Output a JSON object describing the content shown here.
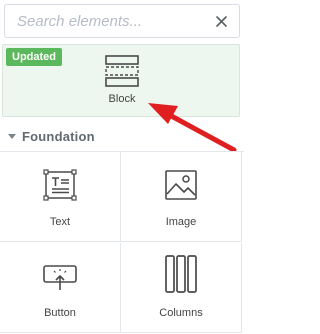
{
  "search": {
    "placeholder": "Search elements..."
  },
  "updated_element": {
    "badge": "Updated",
    "label": "Block",
    "icon": "block-icon"
  },
  "section": {
    "title": "Foundation"
  },
  "elements": [
    {
      "label": "Text",
      "icon": "text-icon"
    },
    {
      "label": "Image",
      "icon": "image-icon"
    },
    {
      "label": "Button",
      "icon": "button-icon"
    },
    {
      "label": "Columns",
      "icon": "columns-icon"
    }
  ],
  "colors": {
    "badge": "#5cb85c",
    "arrow": "#e02020",
    "updated_bg": "#eef6f0",
    "icon_stroke": "#4a4a4a"
  }
}
